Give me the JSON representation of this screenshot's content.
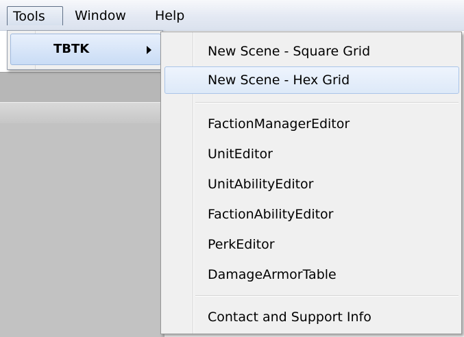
{
  "menubar": {
    "items": [
      {
        "label": "Tools"
      },
      {
        "label": "Window"
      },
      {
        "label": "Help"
      }
    ]
  },
  "tools_menu": {
    "items": [
      {
        "label": "TBTK",
        "has_submenu": true
      }
    ]
  },
  "tbtk_submenu": {
    "groups": [
      [
        {
          "label": "New Scene - Square Grid"
        },
        {
          "label": "New Scene - Hex Grid",
          "hovered": true
        }
      ],
      [
        {
          "label": "FactionManagerEditor"
        },
        {
          "label": "UnitEditor"
        },
        {
          "label": "UnitAbilityEditor"
        },
        {
          "label": "FactionAbilityEditor"
        },
        {
          "label": "PerkEditor"
        },
        {
          "label": "DamageArmorTable"
        }
      ],
      [
        {
          "label": "Contact and Support Info"
        }
      ]
    ]
  },
  "colors": {
    "menu_bg": "#f0f0f0",
    "highlight_border": "#a9c4e8",
    "editor_gray": "#c2c2c2"
  }
}
